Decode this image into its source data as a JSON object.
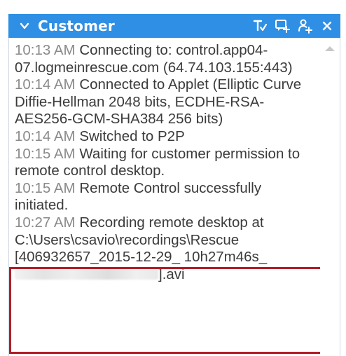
{
  "panel": {
    "title": "Customer",
    "colors": {
      "titlebar": "#2f8fe4",
      "highlight_border": "#b01e28",
      "timestamp": "#8a8a8a",
      "text": "#3b3b3b"
    },
    "icons": [
      "chevron-down-icon",
      "text-format-icon",
      "chat-add-icon",
      "add-user-icon",
      "close-icon"
    ]
  },
  "log": {
    "entries": [
      {
        "time": "10:13 AM",
        "text": "Connecting to: control.app04-07.logmeinrescue.com (64.74.103.155:443)"
      },
      {
        "time": "10:14 AM",
        "text": "Connected to Applet (Elliptic Curve Diffie-Hellman 2048 bits, ECDHE-RSA-AES256-GCM-SHA384 256 bits)"
      },
      {
        "time": "10:14 AM",
        "text": "Switched to P2P"
      },
      {
        "time": "10:15 AM",
        "text": "Waiting for customer permission to remote control desktop."
      },
      {
        "time": "10:15 AM",
        "text": "Remote Control successfully initiated."
      },
      {
        "time": "10:27 AM",
        "text_before": "Recording remote desktop at C:\\Users\\csavio\\recordings\\Rescue [406932657_2015-12-29_ 10h27m46s_",
        "text_after": "].avi"
      }
    ]
  }
}
